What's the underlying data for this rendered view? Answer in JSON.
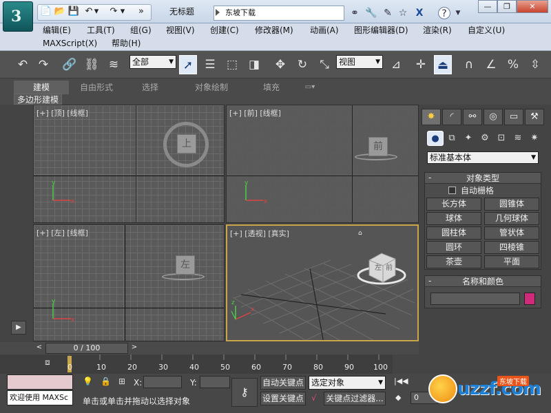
{
  "window": {
    "title": "无标题",
    "search_text": "东坡下载",
    "minimize": "—",
    "restore": "❐",
    "close": "✕"
  },
  "quick_access": [
    "📄",
    "📂",
    "💾",
    "↶",
    "▾",
    "↷",
    "▾",
    "»"
  ],
  "menu": {
    "row1": [
      "编辑(E)",
      "工具(T)",
      "组(G)",
      "视图(V)",
      "创建(C)",
      "修改器(M)",
      "动画(A)",
      "图形编辑器(D)",
      "渲染(R)",
      "自定义(U)"
    ],
    "row2": [
      "MAXScript(X)",
      "帮助(H)"
    ]
  },
  "toolbar": {
    "selection_filter": "全部",
    "ref_coord": "视图"
  },
  "ribbon": {
    "tabs": [
      "建模",
      "自由形式",
      "选择",
      "对象绘制",
      "填充"
    ],
    "sub_label": "多边形建模"
  },
  "viewports": {
    "top": {
      "label": "[+] [顶] [线框]",
      "cube": "上"
    },
    "front": {
      "label": "[+] [前] [线框]",
      "cube": "前"
    },
    "left": {
      "label": "[+] [左] [线框]",
      "cube": "左"
    },
    "persp": {
      "label": "[+] [透视] [真实]",
      "cube_front": "前",
      "cube_left": "左"
    }
  },
  "command_panel": {
    "category": "标准基本体",
    "object_type_title": "对象类型",
    "autogrid": "自动栅格",
    "objects": [
      "长方体",
      "圆锥体",
      "球体",
      "几何球体",
      "圆柱体",
      "管状体",
      "圆环",
      "四棱锥",
      "茶壶",
      "平面"
    ],
    "name_color_title": "名称和颜色",
    "swatch_color": "#d02a7a"
  },
  "timeline": {
    "frame_display": "0 / 100",
    "ticks": [
      "0",
      "10",
      "20",
      "30",
      "40",
      "50",
      "60",
      "70",
      "80",
      "90",
      "100"
    ]
  },
  "status": {
    "maxscript_listener": "欢迎使用 MAXSc",
    "prompt": "单击或单击并拖动以选择对象",
    "x_label": "X:",
    "y_label": "Y:",
    "auto_key": "自动关键点",
    "set_key": "设置关键点",
    "key_filter": "关键点过滤器...",
    "selected_set": "选定对象",
    "frame_field": "0"
  },
  "watermark": {
    "brand": "uzzf.com",
    "sub": "东坡下载"
  }
}
